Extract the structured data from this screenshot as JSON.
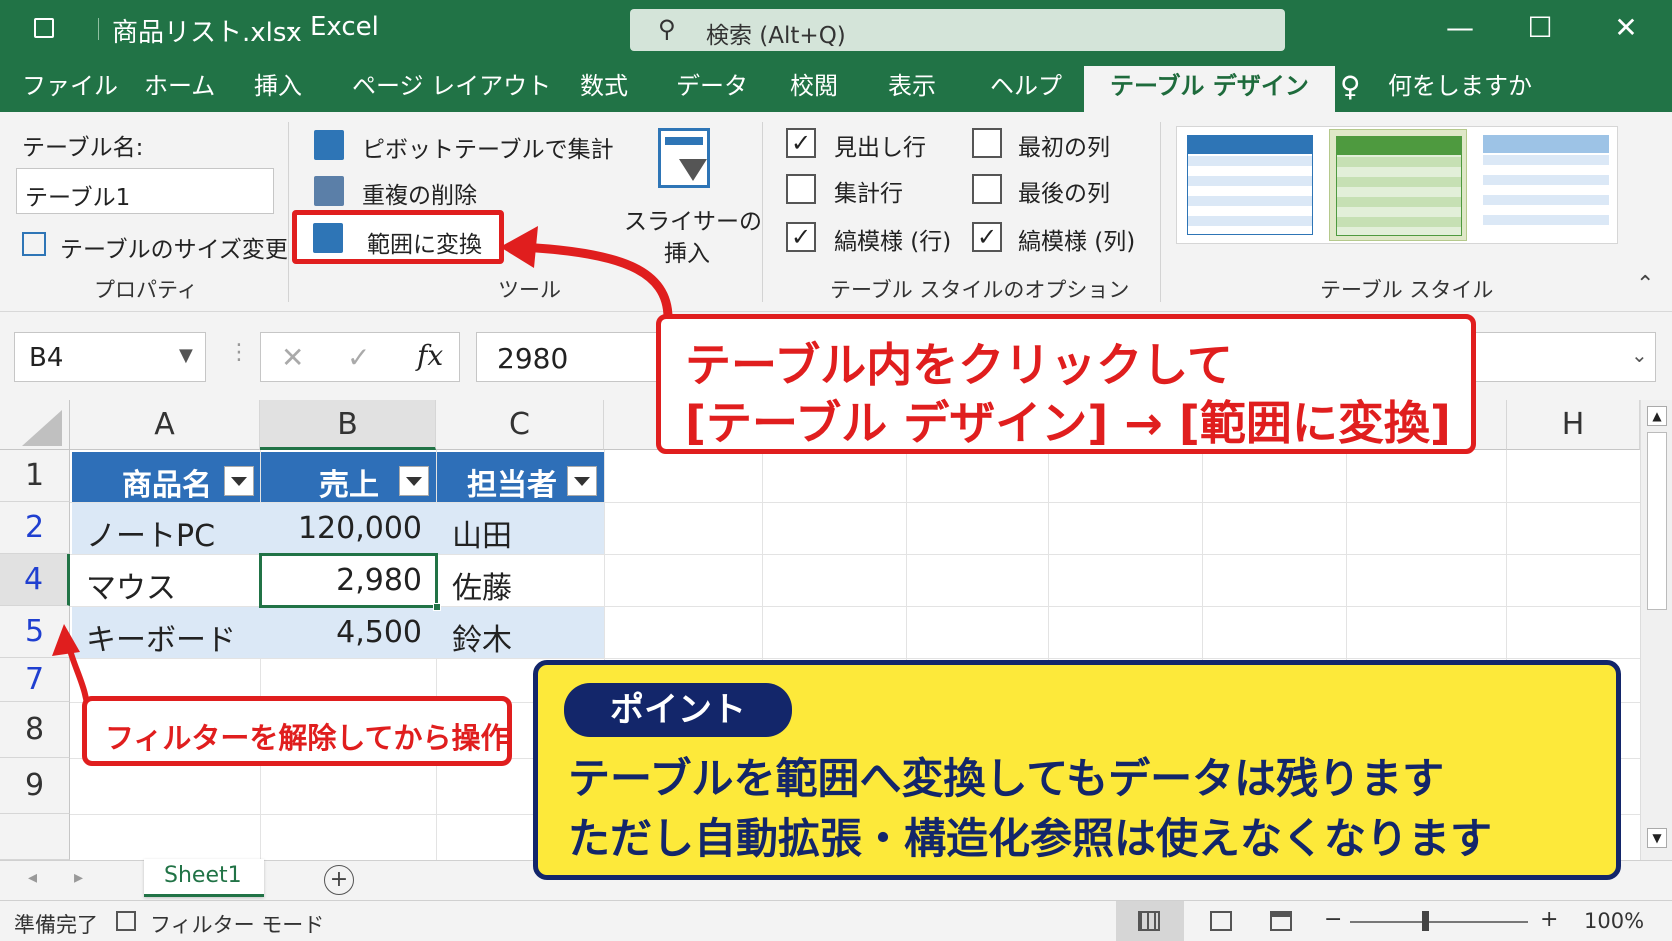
{
  "window": {
    "file_title": "商品リスト.xlsx",
    "separator": "-",
    "app_name": "Excel",
    "search_placeholder": "検索 (Alt+Q)"
  },
  "tabs": [
    "ファイル",
    "ホーム",
    "挿入",
    "ページ レイアウト",
    "数式",
    "データ",
    "校閲",
    "表示",
    "ヘルプ",
    "テーブル デザイン"
  ],
  "tell_me": "何をしますか",
  "ribbon": {
    "properties": {
      "table_name_label": "テーブル名:",
      "table_name_value": "テーブル1",
      "resize_label": "テーブルのサイズ変更",
      "group_label": "プロパティ"
    },
    "tools": {
      "pivot_label": "ピボットテーブルで集計",
      "remove_dup_label": "重複の削除",
      "convert_label": "範囲に変換",
      "slicer_label_1": "スライサーの",
      "slicer_label_2": "挿入",
      "group_label": "ツール"
    },
    "style_options": {
      "header_row": "見出し行",
      "first_column": "最初の列",
      "total_row": "集計行",
      "last_column": "最後の列",
      "banded_rows": "縞模様 (行)",
      "banded_columns": "縞模様 (列)",
      "group_label": "テーブル スタイルのオプション",
      "checked": {
        "header_row": true,
        "first_column": false,
        "total_row": false,
        "last_column": false,
        "banded_rows": true,
        "banded_columns": true
      }
    },
    "table_styles": {
      "group_label": "テーブル スタイル",
      "swatch_colors": [
        "#2e75b6",
        "#4e9a3f",
        "#9dc3e6"
      ]
    }
  },
  "formula_bar": {
    "name_box": "B4",
    "cancel_symbol": "✕",
    "enter_symbol": "✓",
    "fx_symbol": "fx",
    "formula_value": "2980"
  },
  "sheet": {
    "columns": [
      "A",
      "B",
      "C",
      "H"
    ],
    "row_numbers": [
      "1",
      "2",
      "4",
      "5",
      "7",
      "8",
      "9"
    ],
    "headers": [
      "商品名",
      "売上",
      "担当者"
    ],
    "rows": [
      [
        "ノートPC",
        "120,000",
        "山田"
      ],
      [
        "マウス",
        "2,980",
        "佐藤"
      ],
      [
        "キーボード",
        "4,500",
        "鈴木"
      ]
    ]
  },
  "sheet_tabs": {
    "active": "Sheet1",
    "add_symbol": "+"
  },
  "status_bar": {
    "ready": "準備完了",
    "filter_mode": "フィルター モード",
    "zoom": "100%",
    "zoom_minus": "−",
    "zoom_plus": "+"
  },
  "callouts": {
    "main_line_1": "テーブル内をクリックして",
    "main_line_2": "[テーブル デザイン] → [範囲に変換]",
    "filter_note": "フィルターを解除してから操作",
    "point_label": "ポイント",
    "point_line_1": "テーブルを範囲へ変換してもデータは残ります",
    "point_line_2": "ただし自動拡張・構造化参照は使えなくなります"
  },
  "colors": {
    "excel_green": "#217346",
    "table_header_blue": "#2e6fb8",
    "table_band_blue": "#dbe8f6",
    "callout_red": "#e01e1e",
    "point_yellow": "#fde93a",
    "point_navy": "#13266a"
  }
}
